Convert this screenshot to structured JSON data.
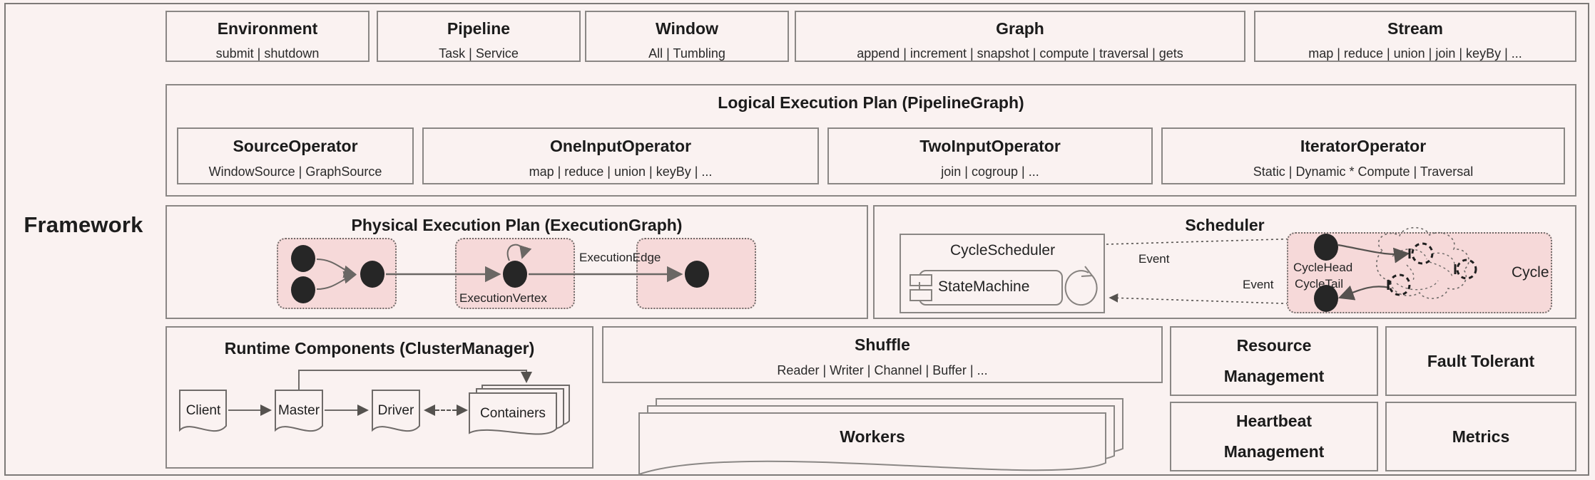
{
  "diagram": {
    "framework_label": "Framework",
    "api_row": [
      {
        "title": "Environment",
        "subtitle": "submit | shutdown"
      },
      {
        "title": "Pipeline",
        "subtitle": "Task | Service"
      },
      {
        "title": "Window",
        "subtitle": "All | Tumbling"
      },
      {
        "title": "Graph",
        "subtitle": "append | increment | snapshot | compute | traversal | gets"
      },
      {
        "title": "Stream",
        "subtitle": "map | reduce | union | join | keyBy | ..."
      }
    ],
    "logical_plan": {
      "title": "Logical Execution Plan (PipelineGraph)",
      "operators": [
        {
          "title": "SourceOperator",
          "subtitle": "WindowSource | GraphSource"
        },
        {
          "title": "OneInputOperator",
          "subtitle": "map | reduce | union | keyBy | ..."
        },
        {
          "title": "TwoInputOperator",
          "subtitle": "join | cogroup | ..."
        },
        {
          "title": "IteratorOperator",
          "subtitle": "Static | Dynamic * Compute | Traversal"
        }
      ]
    },
    "physical_plan": {
      "title": "Physical Execution Plan (ExecutionGraph)",
      "vertex_label": "ExecutionVertex",
      "edge_label": "ExecutionEdge"
    },
    "scheduler": {
      "title": "Scheduler",
      "cycle_scheduler_label": "CycleScheduler",
      "state_machine_label": "StateMachine",
      "event_label_top": "Event",
      "event_label_bottom": "Event",
      "cycle_head_label": "CycleHead",
      "cycle_tail_label": "CycleTail",
      "cycle_label": "Cycle"
    },
    "runtime": {
      "title": "Runtime Components (ClusterManager)",
      "nodes": [
        "Client",
        "Master",
        "Driver",
        "Containers"
      ]
    },
    "shuffle": {
      "title": "Shuffle",
      "subtitle": "Reader | Writer | Channel | Buffer | ..."
    },
    "workers": {
      "title": "Workers"
    },
    "side_cards": [
      {
        "line1": "Resource",
        "line2": "Management"
      },
      {
        "line1": "Fault Tolerant",
        "line2": ""
      },
      {
        "line1": "Heartbeat",
        "line2": "Management"
      },
      {
        "line1": "Metrics",
        "line2": ""
      }
    ],
    "colors": {
      "background": "#faf2f1",
      "border": "#8a8785",
      "pink": "#f6d9d9",
      "node": "#262626",
      "text": "#1b1b1b"
    }
  }
}
